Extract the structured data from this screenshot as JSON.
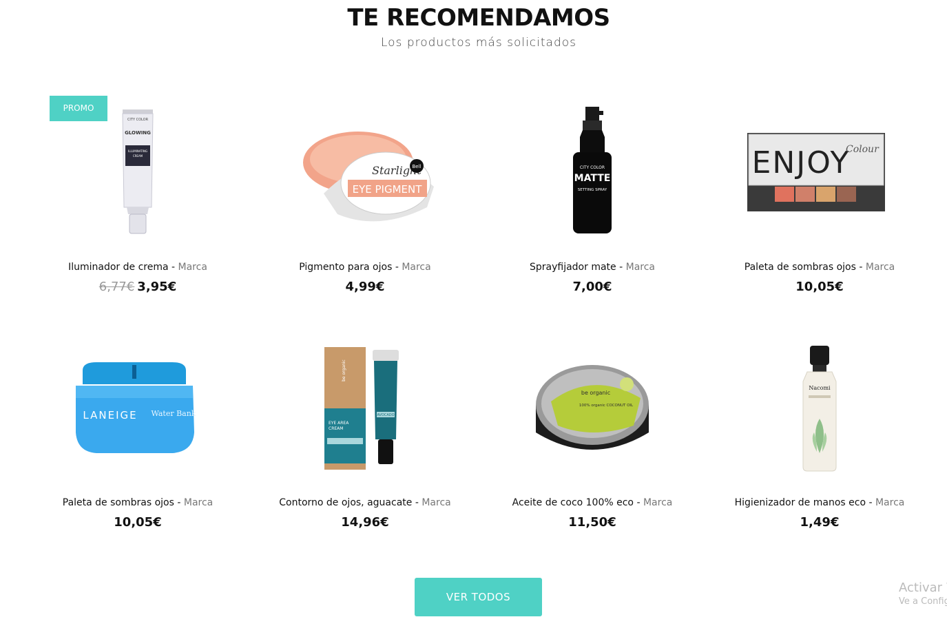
{
  "header": {
    "title": "TE RECOMENDAMOS",
    "subtitle": "Los productos más solicitados"
  },
  "products": [
    {
      "name": "Iluminador de crema",
      "separator": " - ",
      "brand": "Marca",
      "old_price": "6,77€",
      "price": "3,95€",
      "badge": "PROMO",
      "image_icon": "cream-tube-icon"
    },
    {
      "name": "Pigmento para ojos",
      "separator": " - ",
      "brand": "Marca",
      "old_price": "",
      "price": "4,99€",
      "badge": "",
      "image_icon": "eye-pigment-jar-icon"
    },
    {
      "name": "Sprayfijador mate",
      "separator": " - ",
      "brand": "Marca",
      "old_price": "",
      "price": "7,00€",
      "badge": "",
      "image_icon": "spray-bottle-icon"
    },
    {
      "name": "Paleta de sombras ojos",
      "separator": " - ",
      "brand": "Marca",
      "old_price": "",
      "price": "10,05€",
      "badge": "",
      "image_icon": "eyeshadow-palette-icon"
    },
    {
      "name": "Paleta de sombras ojos",
      "separator": " - ",
      "brand": "Marca",
      "old_price": "",
      "price": "10,05€",
      "badge": "",
      "image_icon": "blue-cream-jar-icon"
    },
    {
      "name": "Contorno de ojos, aguacate",
      "separator": " - ",
      "brand": "Marca",
      "old_price": "",
      "price": "14,96€",
      "badge": "",
      "image_icon": "eye-cream-box-icon"
    },
    {
      "name": "Aceite de coco 100% eco",
      "separator": " - ",
      "brand": "Marca",
      "old_price": "",
      "price": "11,50€",
      "badge": "",
      "image_icon": "coconut-oil-tin-icon"
    },
    {
      "name": "Higienizador de manos eco",
      "separator": " - ",
      "brand": "Marca",
      "old_price": "",
      "price": "1,49€",
      "badge": "",
      "image_icon": "hand-sanitizer-bottle-icon"
    }
  ],
  "image_texts": {
    "tube_brand": "CITY COLOR",
    "tube_line1": "GLOWING",
    "tube_line2": "ILLUMINATING",
    "tube_line3": "CREAM",
    "pigment_script": "Starlight",
    "pigment_brand": "Bell",
    "pigment_label": "EYE PIGMENT",
    "spray_brand": "CITY COLOR",
    "spray_label": "MATTE",
    "spray_sub": "SETTING SPRAY",
    "palette_label": "ENJOY",
    "palette_script": "Colour",
    "laneige_label": "LANEIGE",
    "laneige_sub": "Water Bank",
    "eye_cream_brand": "be organic",
    "eye_cream_label1": "EYE AREA",
    "eye_cream_label2": "CREAM",
    "eye_cream_avocado": "AVOCADO",
    "coconut_brand": "be organic",
    "coconut_label": "100% organic COCONUT OIL",
    "sanitizer_brand": "Nacomi"
  },
  "actions": {
    "view_all": "VER TODOS"
  },
  "watermark": {
    "line1": "Activar W",
    "line2": "Ve a Config"
  },
  "colors": {
    "accent": "#4fd1c5",
    "text": "#111111",
    "muted": "#777777"
  }
}
